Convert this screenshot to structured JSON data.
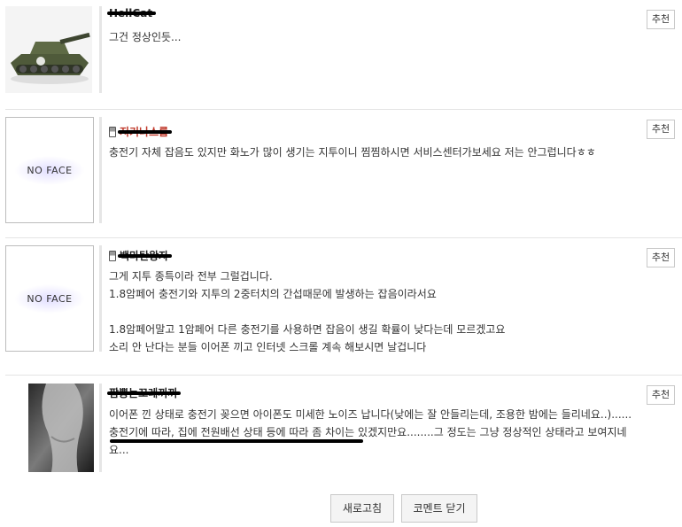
{
  "comments": [
    {
      "nickname": "HellCat",
      "avatar": "tank-photo",
      "has_phone_icon": false,
      "text": "그건 정상인듯...",
      "recommend_label": "추천"
    },
    {
      "nickname": "지키나스룹",
      "avatar": "NO FACE",
      "has_phone_icon": true,
      "text": "충전기 자체 잡음도 있지만 화노가 많이 생기는 지투이니 찜찜하시면 서비스센터가보세요 저는 안그럽니다ㅎㅎ",
      "recommend_label": "추천"
    },
    {
      "nickname": "백마탄왕자",
      "avatar": "NO FACE",
      "has_phone_icon": true,
      "text": "그게 지투 종특이라 전부 그럴겁니다.\n1.8암페어 충전기와 지투의 2중터치의 간섭때문에 발생하는 잡음이라서요\n\n1.8암페어말고 1암페어 다른 충전기를 사용하면 잡음이 생길 확률이 낮다는데 모르겠고요\n소리 안 난다는 분들 이어폰 끼고 인터넷 스크롤 계속 해보시면 날겁니다",
      "recommend_label": "추천"
    },
    {
      "nickname": "짬뽕는꼬레끼끼",
      "avatar": "bw-photo",
      "has_phone_icon": false,
      "text": "이어폰 낀 상태로 충전기 꽂으면 아이폰도 미세한 노이즈 납니다(낮에는 잘 안들리는데, 조용한 밤에는 들리네요..)......\n충전기에 따라, 집에 전원배선 상태 등에 따라 좀 차이는 있겠지만요........그 정도는 그냥 정상적인 상태라고 보여지네\n요...",
      "recommend_label": "추천"
    }
  ],
  "buttons": {
    "refresh": "새로고침",
    "close_comments": "코멘트 닫기"
  }
}
